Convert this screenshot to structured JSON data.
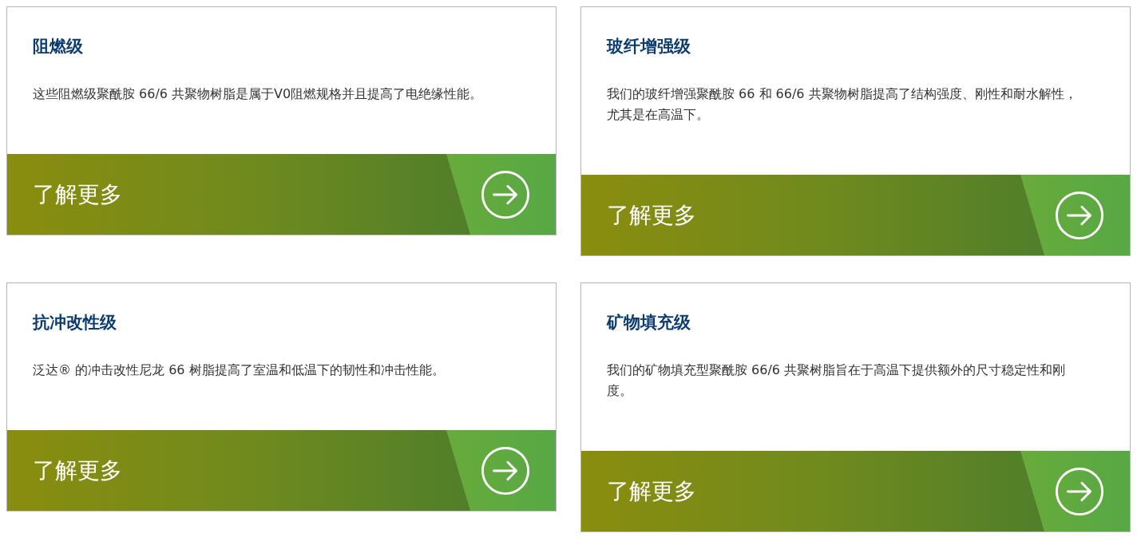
{
  "cards": [
    {
      "title": "阻燃级",
      "description": "这些阻燃级聚酰胺 66/6 共聚物树脂是属于V0阻燃规格并且提高了电绝缘性能。",
      "link": "了解更多"
    },
    {
      "title": "玻纤增强级",
      "description": "我们的玻纤增强聚酰胺 66 和 66/6 共聚物树脂提高了结构强度、刚性和耐水解性，尤其是在高温下。",
      "link": "了解更多"
    },
    {
      "title": "抗冲改性级",
      "description": "泛达® 的冲击改性尼龙 66 树脂提高了室温和低温下的韧性和冲击性能。",
      "link": "了解更多"
    },
    {
      "title": "矿物填充级",
      "description": "我们的矿物填充型聚酰胺 66/6 共聚树脂旨在于高温下提供额外的尺寸稳定性和刚度。",
      "link": "了解更多"
    }
  ]
}
